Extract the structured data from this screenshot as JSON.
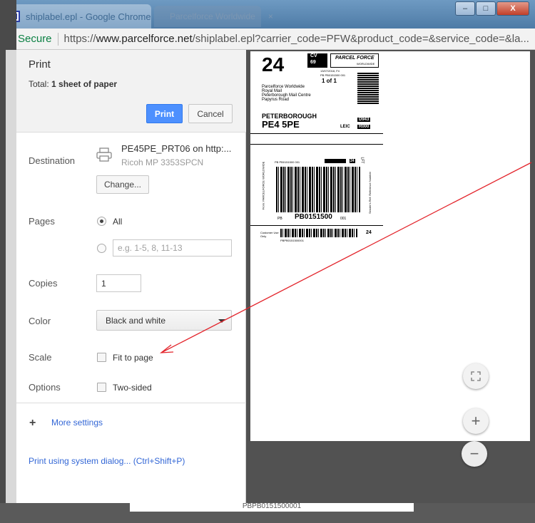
{
  "browser": {
    "active_tab_title": "shiplabel.epl - Google Chrome",
    "inactive_tab_title": "Parcelforce Worldwide",
    "window_controls": {
      "minimize": "–",
      "maximize": "□",
      "close": "X"
    },
    "secure_label": "Secure",
    "url_scheme": "https://",
    "url_host": "www.parcelforce.net",
    "url_rest": "/shiplabel.epl?carrier_code=PFW&product_code=&service_code=&la..."
  },
  "print": {
    "title": "Print",
    "total_prefix": "Total: ",
    "total_value": "1 sheet of paper",
    "print_button": "Print",
    "cancel_button": "Cancel",
    "destination_label": "Destination",
    "destination_name": "PE45PE_PRT06 on http:...",
    "destination_sub": "Ricoh MP 3353SPCN",
    "change_button": "Change...",
    "pages_label": "Pages",
    "pages_all": "All",
    "pages_placeholder": "e.g. 1-5, 8, 11-13",
    "copies_label": "Copies",
    "copies_value": "1",
    "color_label": "Color",
    "color_value": "Black and white",
    "scale_label": "Scale",
    "fit_to_page": "Fit to page",
    "options_label": "Options",
    "two_sided": "Two-sided",
    "more_settings_icon": "+",
    "more_settings": "More settings",
    "system_dialog": "Print using system dialog... (Ctrl+Shift+P)"
  },
  "label": {
    "big_number": "24",
    "cv": "CV",
    "cv_num": "69",
    "logo": "PARCEL FORCE",
    "logo_sub": "WORLDWIDE",
    "date": "13/07/2018, Fri",
    "ref_small": "PB PB0151500 001",
    "of": "1 of 1",
    "addr1": "Parcelforce Worldwide",
    "addr2": "Royal Mail",
    "addr3": "Peterborough Mail Centre",
    "addr4": "Papyrus Road",
    "town": "PETERBOROUGH",
    "postcode": "PE4 5PE",
    "depot": "D943",
    "leic": "LEIC",
    "route": "R000",
    "barcode_top": "PB PB0151500 001",
    "bar_num": "24",
    "lft": "LFT",
    "pb": "PB",
    "tracking": "PB0151500",
    "tracking_suffix": "001",
    "customer_use": "Customer Use Only",
    "small_ref": "PBPB0151500001",
    "bottom_24": "24",
    "side_left": "From: PARCELFORCE WORLDWIDE",
    "side_right": "Sender's Ref: Reference Number",
    "bottom_peek": "PBPB0151500001"
  }
}
